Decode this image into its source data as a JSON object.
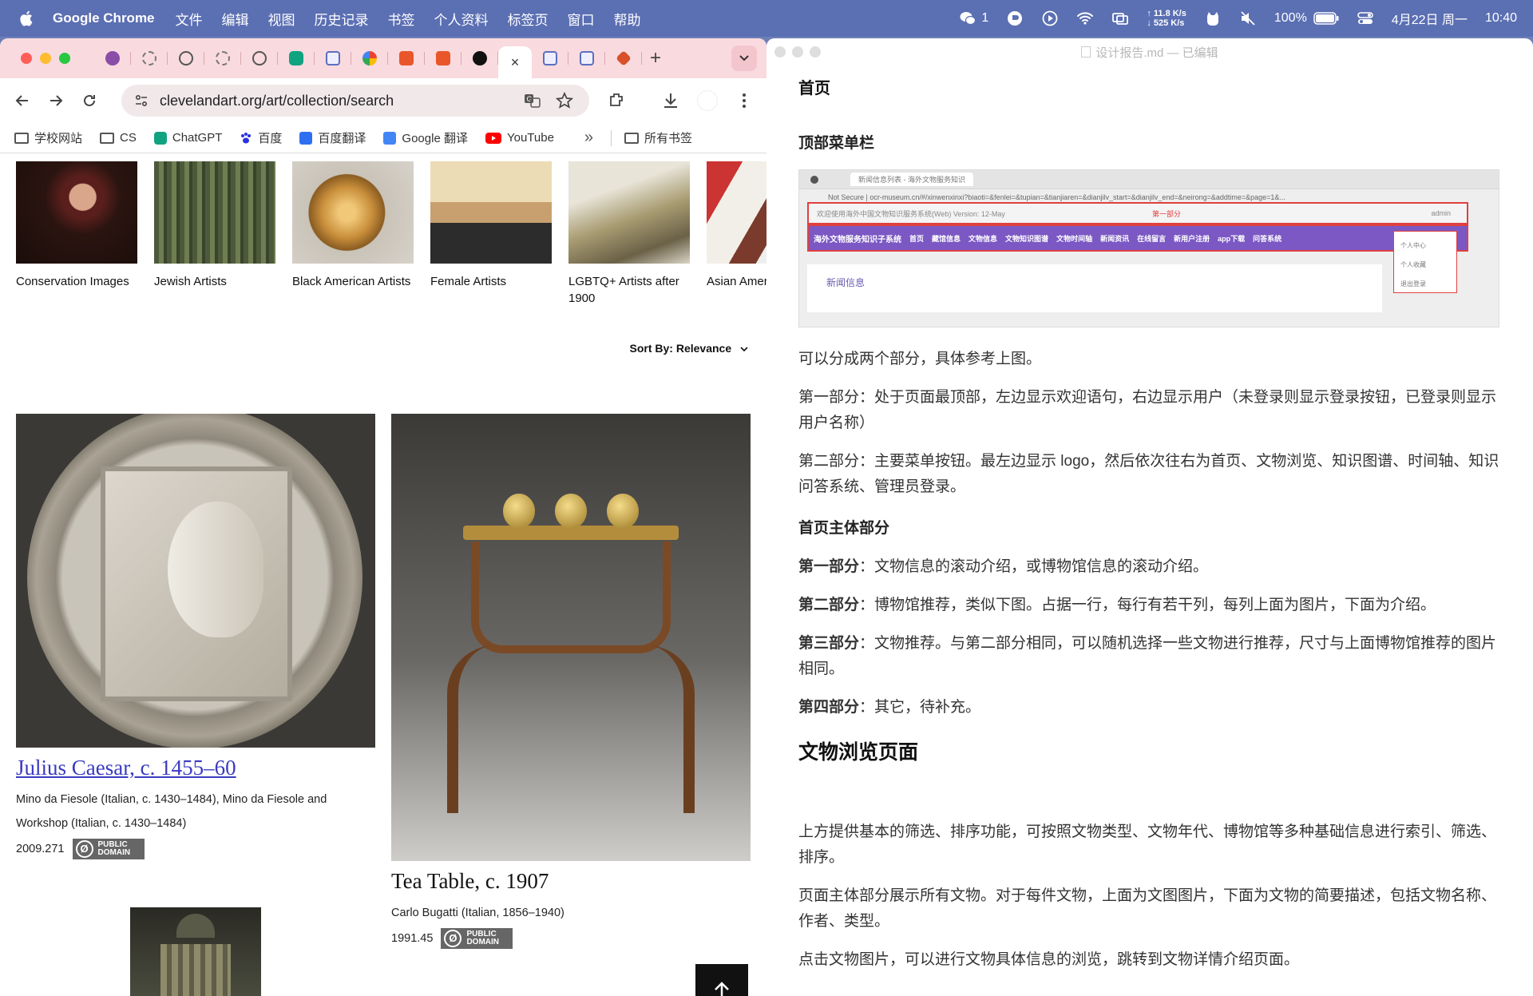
{
  "menubar": {
    "app": "Google Chrome",
    "menus": [
      "文件",
      "编辑",
      "视图",
      "历史记录",
      "书签",
      "个人资料",
      "标签页",
      "窗口",
      "帮助"
    ],
    "wechat_count": "1",
    "net_up": "↑ 11.8 K/s",
    "net_down": "↓ 525 K/s",
    "battery": "100%",
    "date": "4月22日 周一",
    "time": "10:40"
  },
  "chrome": {
    "active_tab_close": "×",
    "new_tab": "+",
    "url": "clevelandart.org/art/collection/search",
    "bookmarks": [
      "学校网站",
      "CS",
      "ChatGPT",
      "百度",
      "百度翻译",
      "Google 翻译",
      "YouTube"
    ],
    "more_bookmarks": "»",
    "all_bookmarks": "所有书签"
  },
  "page": {
    "categories": [
      "Conservation Images",
      "Jewish Artists",
      "Black American Artists",
      "Female Artists",
      "LGBTQ+ Artists after 1900",
      "Asian American Artists"
    ],
    "sort_label": "Sort By: Relevance",
    "artworks": [
      {
        "title": "Julius Caesar, c. 1455–60",
        "artist": "Mino da Fiesole (Italian, c. 1430–1484), Mino da Fiesole and Workshop (Italian, c. 1430–1484)",
        "accession": "2009.271",
        "badge": "PUBLIC DOMAIN"
      },
      {
        "title": "Tea Table, c. 1907",
        "artist": "Carlo Bugatti (Italian, 1856–1940)",
        "accession": "1991.45",
        "badge": "PUBLIC DOMAIN"
      }
    ]
  },
  "editor": {
    "title": "设计报告.md — 已编辑",
    "heading_home": "首页",
    "heading_topmenu": "顶部菜单栏",
    "mock": {
      "url": "Not Secure  |  ocr-museum.cn/#/xinwenxinxi?biaoti=&fenlei=&tupian=&tianjiaren=&dianjilv_start=&dianjilv_end=&neirong=&addtime=&page=1&...",
      "welcome": "欢迎使用海外中国文物知识服务系统(Web) Version: 12-May",
      "part_one": "第一部分",
      "user": "admin",
      "logo": "海外文物服务知识子系统",
      "nav": [
        "首页",
        "藏馆信息",
        "文物信息",
        "文物知识图谱",
        "文物时间轴",
        "新闻资讯",
        "在线留言",
        "新用户注册",
        "app下载",
        "问答系统"
      ],
      "dropdown": [
        "个人中心",
        "个人收藏",
        "退出登录"
      ],
      "section": "新闻信息"
    },
    "p1": "可以分成两个部分，具体参考上图。",
    "p2": "第一部分：处于页面最顶部，左边显示欢迎语句，右边显示用户（未登录则显示登录按钮，已登录则显示用户名称）",
    "p3": "第二部分：主要菜单按钮。最左边显示 logo，然后依次往右为首页、文物浏览、知识图谱、时间轴、知识问答系统、管理员登录。",
    "heading_main": "首页主体部分",
    "items": [
      {
        "label": "第一部分",
        "text": "：文物信息的滚动介绍，或博物馆信息的滚动介绍。"
      },
      {
        "label": "第二部分",
        "text": "：博物馆推荐，类似下图。占据一行，每行有若干列，每列上面为图片，下面为介绍。"
      },
      {
        "label": "第三部分",
        "text": "：文物推荐。与第二部分相同，可以随机选择一些文物进行推荐，尺寸与上面博物馆推荐的图片相同。"
      },
      {
        "label": "第四部分",
        "text": "：其它，待补充。"
      }
    ],
    "heading_browse": "文物浏览页面",
    "p4": "上方提供基本的筛选、排序功能，可按照文物类型、文物年代、博物馆等多种基础信息进行索引、筛选、排序。",
    "p5": "页面主体部分展示所有文物。对于每件文物，上面为文图图片，下面为文物的简要描述，包括文物名称、作者、类型。",
    "p6": "点击文物图片，可以进行文物具体信息的浏览，跳转到文物详情介绍页面。"
  }
}
